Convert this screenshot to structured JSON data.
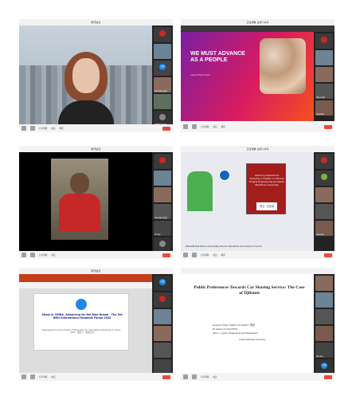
{
  "panels": [
    {
      "title": "腾讯会议",
      "rail": [
        "",
        "",
        "王路",
        "Georgia 正道",
        "",
        "",
        "刘锦钊 2024"
      ],
      "toolbar": [
        "静音",
        "开启视频",
        "共享屏幕",
        "成员",
        "聊天",
        "录制",
        "结束会议"
      ]
    },
    {
      "title": "正在观看 主持人共享",
      "slide_title": "WE MUST ADVANCE AS A PEOPLE",
      "slide_sub": "Lazar Prepmovic",
      "rail": [
        "",
        "",
        "",
        "Recorder",
        "Georgia",
        "",
        "Recording"
      ],
      "toolbar": [
        "静音",
        "开启视频",
        "共享屏幕",
        "成员",
        "聊天",
        "结束"
      ]
    },
    {
      "title": "腾讯会议",
      "rail": [
        "",
        "",
        "Georgia 正道",
        "Trinity",
        "",
        "",
        ""
      ],
      "toolbar": [
        "静音",
        "开启视频",
        "共享屏幕",
        "成员",
        "聊天",
        "结束会议"
      ]
    },
    {
      "title": "正在观看 主持人共享",
      "card_text": "Learning experience studying a master on Marine Engine Engineering at Dalian Maritime University",
      "card_sig": "李玉 · 高宏博",
      "caption": "DALIAN Maritime University Alumni Students and Alumni Forum",
      "rail": [
        "",
        "",
        "",
        "",
        "Georgia",
        "",
        ""
      ],
      "toolbar": [
        "静音",
        "开启视频",
        "共享屏幕",
        "成员",
        "聊天",
        "录制",
        "结束"
      ]
    },
    {
      "title": "腾讯会议",
      "slide_title": "Study in CHINA, Advancing for the Blue Dream · The 3rd DMU International Students Forum 2022",
      "slide_sub": "Management of the Quality of Education for International Students in China · 2022 · 报告人 · 联系方式",
      "rail": [
        "王路",
        "",
        "",
        "",
        "",
        "",
        ""
      ],
      "toolbar": [
        "静音",
        "开启视频",
        "共享屏幕",
        "成员",
        "聊天",
        "结束会议"
      ]
    },
    {
      "title": "",
      "slide_title": "Public Preferences Towards Car Sharing Service: The Case of Djibouti",
      "presenter": "Presenter Name:  WADIS ALI ADEN / 李想",
      "id_number": "ID number:  01202100039",
      "major": "Major:  Logistics Engineering and Management",
      "university": "Dalian Maritime University",
      "rail": [
        "",
        "",
        "",
        "",
        "",
        "Kanala",
        "王路"
      ],
      "toolbar": [
        "静音",
        "开启视频",
        "共享屏幕",
        "成员",
        "聊天",
        "结束"
      ]
    }
  ],
  "colors": {
    "slide2_purple": "#7b1fa2",
    "slide2_pink": "#d81b60",
    "card_red": "#a31d1d",
    "ppt_ribbon": "#c43e1c"
  }
}
